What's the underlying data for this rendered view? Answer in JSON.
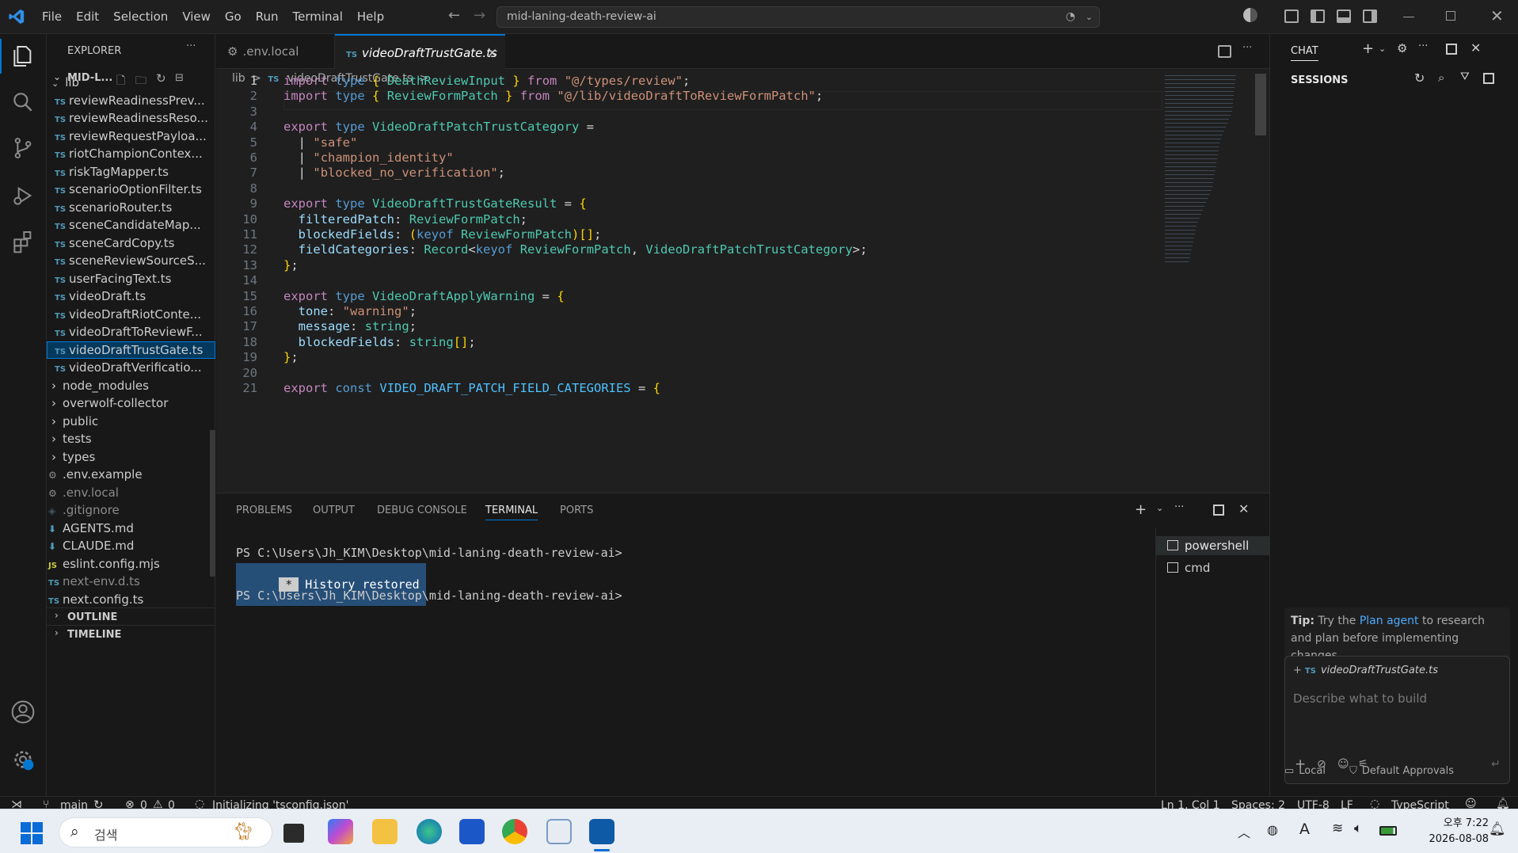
{
  "titlebar": {
    "menus": [
      "File",
      "Edit",
      "Selection",
      "View",
      "Go",
      "Run",
      "Terminal",
      "Help"
    ],
    "search_text": "mid-laning-death-review-ai"
  },
  "explorer": {
    "title": "EXPLORER",
    "root": "MID-L...",
    "items": [
      {
        "label": "lib",
        "kind": "folder-open"
      },
      {
        "label": "reviewReadinessPrev...",
        "kind": "ts"
      },
      {
        "label": "reviewReadinessReso...",
        "kind": "ts"
      },
      {
        "label": "reviewRequestPayloa...",
        "kind": "ts"
      },
      {
        "label": "riotChampionContex...",
        "kind": "ts"
      },
      {
        "label": "riskTagMapper.ts",
        "kind": "ts"
      },
      {
        "label": "scenarioOptionFilter.ts",
        "kind": "ts"
      },
      {
        "label": "scenarioRouter.ts",
        "kind": "ts"
      },
      {
        "label": "sceneCandidateMap...",
        "kind": "ts"
      },
      {
        "label": "sceneCardCopy.ts",
        "kind": "ts"
      },
      {
        "label": "sceneReviewSourceS...",
        "kind": "ts"
      },
      {
        "label": "userFacingText.ts",
        "kind": "ts"
      },
      {
        "label": "videoDraft.ts",
        "kind": "ts"
      },
      {
        "label": "videoDraftRiotConte...",
        "kind": "ts"
      },
      {
        "label": "videoDraftToReviewF...",
        "kind": "ts"
      },
      {
        "label": "videoDraftTrustGate.ts",
        "kind": "ts",
        "selected": true
      },
      {
        "label": "videoDraftVerificatio...",
        "kind": "ts"
      },
      {
        "label": "node_modules",
        "kind": "folder"
      },
      {
        "label": "overwolf-collector",
        "kind": "folder"
      },
      {
        "label": "public",
        "kind": "folder"
      },
      {
        "label": "tests",
        "kind": "folder"
      },
      {
        "label": "types",
        "kind": "folder"
      },
      {
        "label": ".env.example",
        "kind": "gear"
      },
      {
        "label": ".env.local",
        "kind": "gear"
      },
      {
        "label": ".gitignore",
        "kind": "git"
      },
      {
        "label": "AGENTS.md",
        "kind": "md"
      },
      {
        "label": "CLAUDE.md",
        "kind": "md"
      },
      {
        "label": "eslint.config.mjs",
        "kind": "js"
      },
      {
        "label": "next-env.d.ts",
        "kind": "ts"
      },
      {
        "label": "next.config.ts",
        "kind": "ts"
      }
    ],
    "outline": "OUTLINE",
    "timeline": "TIMELINE"
  },
  "tabs": [
    {
      "label": ".env.local",
      "active": false
    },
    {
      "label": "videoDraftTrustGate.ts",
      "active": true
    }
  ],
  "breadcrumb": {
    "a": "lib",
    "sep": ">",
    "b": "videoDraftTrustGate.ts",
    "c": "..."
  },
  "code_lines": [
    "import type { DeathReviewInput } from \"@/types/review\";",
    "import type { ReviewFormPatch } from \"@/lib/videoDraftToReviewFormPatch\";",
    "",
    "export type VideoDraftPatchTrustCategory =",
    "  | \"safe\"",
    "  | \"champion_identity\"",
    "  | \"blocked_no_verification\";",
    "",
    "export type VideoDraftTrustGateResult = {",
    "  filteredPatch: ReviewFormPatch;",
    "  blockedFields: (keyof ReviewFormPatch)[];",
    "  fieldCategories: Record<keyof ReviewFormPatch, VideoDraftPatchTrustCategory>;",
    "};",
    "",
    "export type VideoDraftApplyWarning = {",
    "  tone: \"warning\";",
    "  message: string;",
    "  blockedFields: string[];",
    "};",
    "",
    "export const VIDEO_DRAFT_PATCH_FIELD_CATEGORIES = {"
  ],
  "panel": {
    "tabs": [
      "PROBLEMS",
      "OUTPUT",
      "DEBUG CONSOLE",
      "TERMINAL",
      "PORTS"
    ],
    "active_tab": "TERMINAL",
    "prompt1": "PS C:\\Users\\Jh_KIM\\Desktop\\mid-laning-death-review-ai>",
    "history_star": "*",
    "history_text": "History restored",
    "prompt2": "PS C:\\Users\\Jh_KIM\\Desktop\\mid-laning-death-review-ai>",
    "terminals": [
      "powershell",
      "cmd"
    ]
  },
  "chat": {
    "title": "CHAT",
    "sessions": "SESSIONS",
    "tip_bold": "Tip:",
    "tip_a": "Try the",
    "tip_link": "Plan agent",
    "tip_b": "to research and plan before implementing changes.",
    "context_file": "videoDraftTrustGate.ts",
    "placeholder": "Describe what to build",
    "local": "Local",
    "approvals": "Default Approvals"
  },
  "status": {
    "branch": "main",
    "errors": "0",
    "warnings": "0",
    "initializing": "Initializing 'tsconfig.json'",
    "position": "Ln 1, Col 1",
    "spaces": "Spaces: 2",
    "encoding": "UTF-8",
    "eol": "LF",
    "language": "TypeScript"
  },
  "taskbar": {
    "search": "검색",
    "time": "오후 7:22",
    "date": "2026-08-08"
  },
  "colors": {
    "accent": "#0078d4",
    "selection": "#04395e",
    "editor_bg": "#1f1f1f",
    "taskbar_bg": "#e9eef5"
  }
}
